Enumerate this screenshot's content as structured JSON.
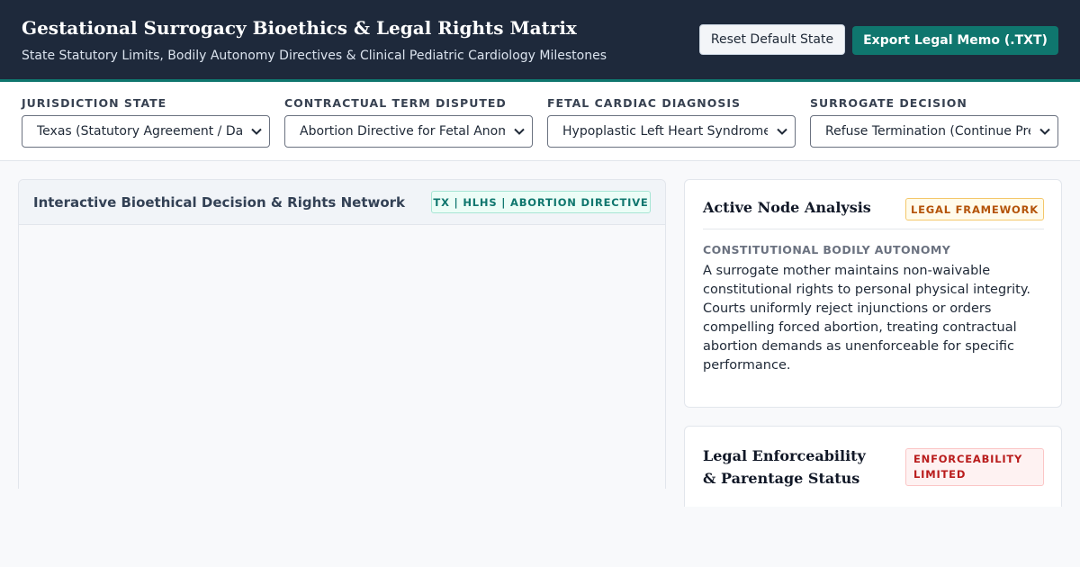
{
  "header": {
    "title": "Gestational Surrogacy Bioethics & Legal Rights Matrix",
    "subtitle": "State Statutory Limits, Bodily Autonomy Directives & Clinical Pediatric Cardiology Milestones",
    "reset_label": "Reset Default State",
    "export_label": "Export Legal Memo (.TXT)"
  },
  "filters": [
    {
      "label": "JURISDICTION STATE",
      "value": "Texas (Statutory Agreement / Da"
    },
    {
      "label": "CONTRACTUAL TERM DISPUTED",
      "value": "Abortion Directive for Fetal Anom"
    },
    {
      "label": "FETAL CARDIAC DIAGNOSIS",
      "value": "Hypoplastic Left Heart Syndrome"
    },
    {
      "label": "SURROGATE DECISION",
      "value": "Refuse Termination (Continue Pre"
    }
  ],
  "network": {
    "title": "Interactive Bioethical Decision & Rights Network",
    "badge": "TX | HLHS | ABORTION DIRECTIVE"
  },
  "node_analysis": {
    "title": "Active Node Analysis",
    "badge": "LEGAL FRAMEWORK",
    "heading": "CONSTITUTIONAL BODILY AUTONOMY",
    "body": "A surrogate mother maintains non-waivable constitutional rights to personal physical integrity. Courts uniformly reject injunctions or orders compelling forced abortion, treating contractual abortion demands as unenforceable for specific performance."
  },
  "enforceability": {
    "title": "Legal Enforceability & Parentage Status",
    "badge": "ENFORCEABILITY LIMITED"
  },
  "colors": {
    "header_bg": "#1e293b",
    "accent": "#0f766e",
    "warning": "#b45309",
    "danger": "#b91c1c"
  },
  "icons": {
    "select_arrow": "chevron-down-icon"
  }
}
